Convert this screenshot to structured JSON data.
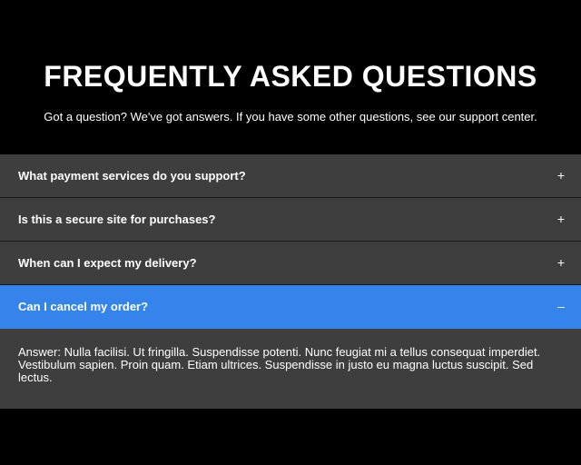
{
  "header": {
    "title": "FREQUENTLY ASKED QUESTIONS",
    "subtitle": "Got a question? We've got answers. If you have some other questions, see our support center."
  },
  "faq": {
    "items": [
      {
        "question": "What payment services do you support?",
        "icon": "+",
        "icon_name": "plus-icon",
        "expanded": false
      },
      {
        "question": "Is this a secure site for purchases?",
        "icon": "+",
        "icon_name": "plus-icon",
        "expanded": false
      },
      {
        "question": "When can I expect my delivery?",
        "icon": "+",
        "icon_name": "plus-icon",
        "expanded": false
      },
      {
        "question": "Can I cancel my order?",
        "icon": "–",
        "icon_name": "minus-icon",
        "expanded": true,
        "answer": "Answer: Nulla facilisi. Ut fringilla. Suspendisse potenti. Nunc feugiat mi a tellus consequat imperdiet. Vestibulum sapien. Proin quam. Etiam ultrices. Suspendisse in justo eu magna luctus suscipit. Sed lectus."
      }
    ]
  },
  "colors": {
    "background": "#000000",
    "item_background": "#3e3e3e",
    "active_background": "#3484ec",
    "text": "#ffffff"
  }
}
